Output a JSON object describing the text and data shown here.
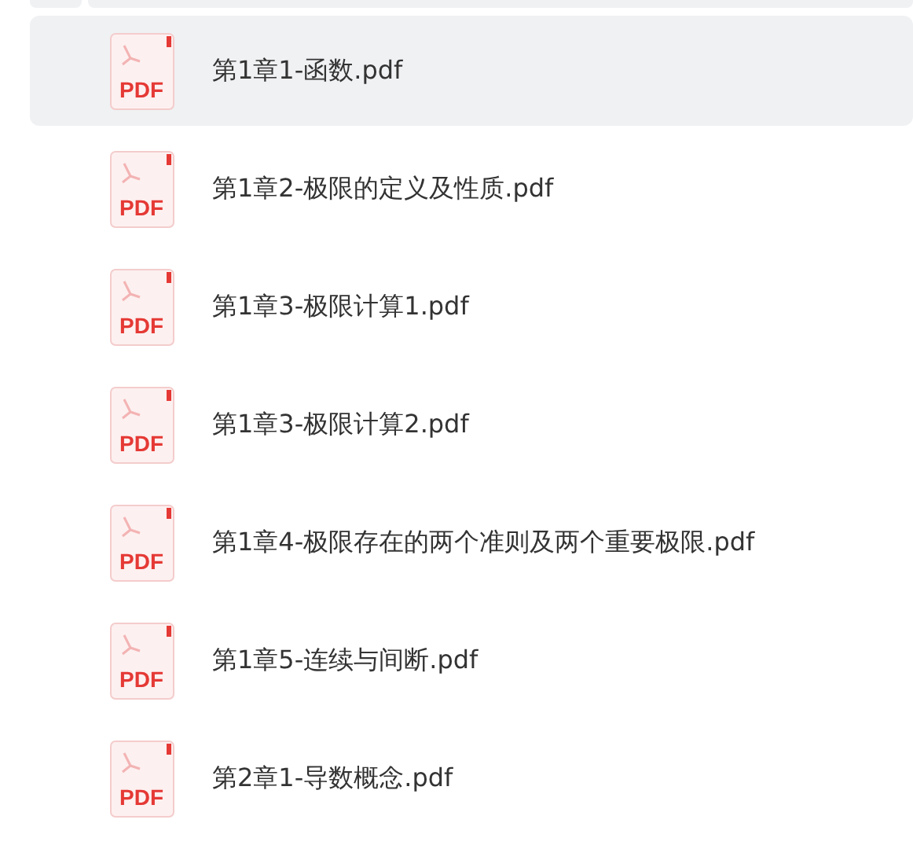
{
  "files": [
    {
      "name": "第1章1-函数.pdf",
      "icon_label": "PDF",
      "selected": true
    },
    {
      "name": "第1章2-极限的定义及性质.pdf",
      "icon_label": "PDF",
      "selected": false
    },
    {
      "name": "第1章3-极限计算1.pdf",
      "icon_label": "PDF",
      "selected": false
    },
    {
      "name": "第1章3-极限计算2.pdf",
      "icon_label": "PDF",
      "selected": false
    },
    {
      "name": "第1章4-极限存在的两个准则及两个重要极限.pdf",
      "icon_label": "PDF",
      "selected": false
    },
    {
      "name": "第1章5-连续与间断.pdf",
      "icon_label": "PDF",
      "selected": false
    },
    {
      "name": "第2章1-导数概念.pdf",
      "icon_label": "PDF",
      "selected": false
    }
  ]
}
